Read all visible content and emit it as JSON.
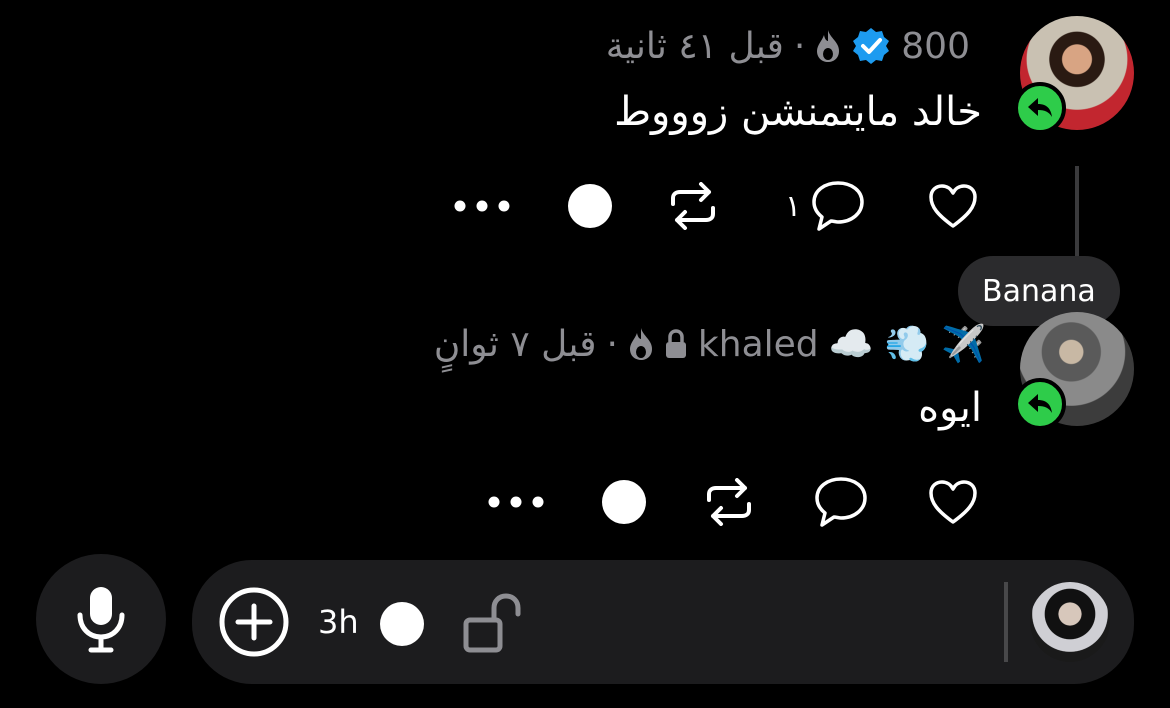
{
  "posts": [
    {
      "username": "800",
      "verified": true,
      "time_text": "قبل ٤١ ثانية",
      "text": "خالد مايتمنشن زوووط",
      "reply_count": "١"
    },
    {
      "username": "khaled",
      "emoji_prefix": "✈️ 💨 ☁️",
      "locked": true,
      "time_text": "قبل ٧ ثوانٍ",
      "text": "ايوه",
      "reply_count": ""
    }
  ],
  "tooltip": {
    "label": "Banana"
  },
  "composer": {
    "timer_label": "3h"
  },
  "colors": {
    "background": "#000000",
    "badge_green": "#2ecc4a",
    "verified_blue": "#1d9bf0",
    "meta_gray": "#8e8e93",
    "composer_bg": "#1c1c1e"
  },
  "icons": [
    "heart-icon",
    "comment-icon",
    "repost-icon",
    "dot-icon",
    "more-icon",
    "reply-arrow-icon",
    "verified-icon",
    "flame-icon",
    "lock-icon",
    "mic-icon",
    "plus-circle-icon",
    "unlock-icon"
  ]
}
